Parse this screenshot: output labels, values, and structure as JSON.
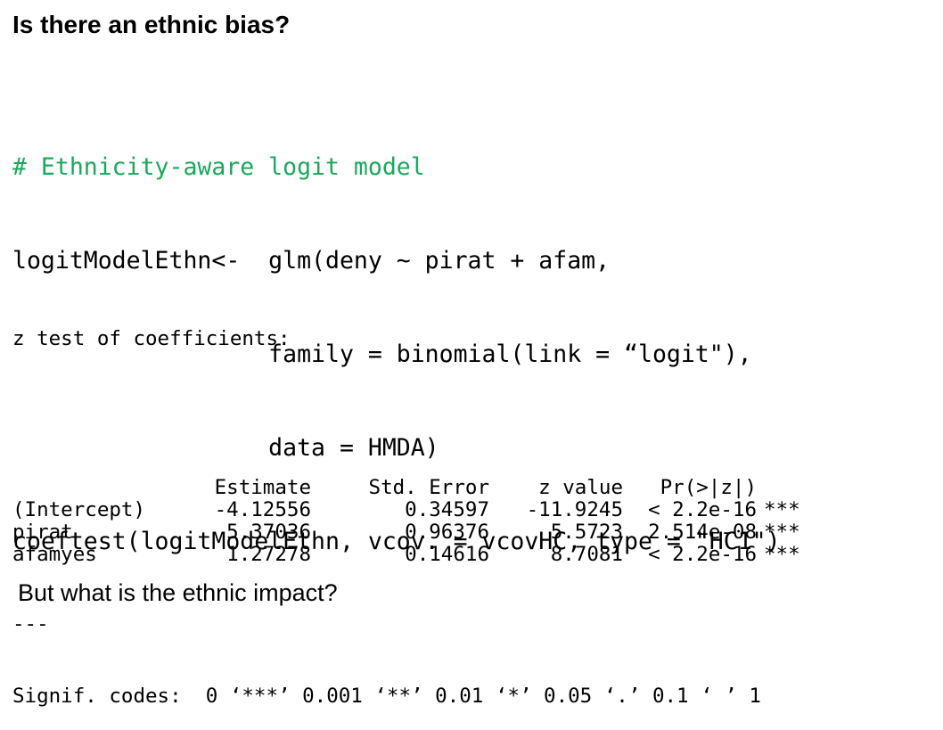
{
  "heading": "Is there an ethnic bias?",
  "code": {
    "comment": "# Ethnicity-aware logit model",
    "line1": "logitModelEthn<-  glm(deny ~ pirat + afam,",
    "line2": "                  family = binomial(link = “logit\"),",
    "line3": "                  data = HMDA)",
    "line4": "coeftest(logitModelEthn, vcov. = vcovHC, type = \"HC1\")"
  },
  "output": {
    "title": "z test of coefficients:",
    "headers": [
      "",
      "Estimate",
      "Std. Error",
      "z value",
      "Pr(>|z|)",
      ""
    ],
    "rows": [
      {
        "name": "(Intercept)",
        "estimate": "-4.12556",
        "std_error": "0.34597",
        "z_value": "-11.9245",
        "p_value": "< 2.2e-16",
        "stars": "***"
      },
      {
        "name": "pirat",
        "estimate": "5.37036",
        "std_error": "0.96376",
        "z_value": "5.5723",
        "p_value": "2.514e-08",
        "stars": "***"
      },
      {
        "name": "afamyes",
        "estimate": "1.27278",
        "std_error": "0.14616",
        "z_value": "8.7081",
        "p_value": "< 2.2e-16",
        "stars": "***"
      }
    ],
    "separator": "---",
    "signif_codes": "Signif. codes:  0 ‘***’ 0.001 ‘**’ 0.01 ‘*’ 0.05 ‘.’ 0.1 ‘ ’ 1"
  },
  "footer": "But what is the ethnic impact?"
}
